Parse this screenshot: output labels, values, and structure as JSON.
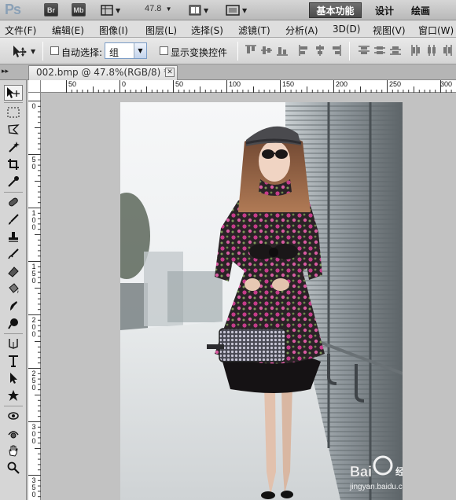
{
  "appbar": {
    "logo": "Ps",
    "bridge_btn": "Br",
    "minibridge_btn": "Mb",
    "zoom": "47.8",
    "workspaces": {
      "active": "基本功能",
      "items": [
        "设计",
        "绘画"
      ]
    }
  },
  "menu": [
    "文件(F)",
    "编辑(E)",
    "图像(I)",
    "图层(L)",
    "选择(S)",
    "滤镜(T)",
    "分析(A)",
    "3D(D)",
    "视图(V)",
    "窗口(W)"
  ],
  "options": {
    "auto_select_label": "自动选择:",
    "auto_select_value": "组",
    "show_transform_label": "显示变换控件"
  },
  "document": {
    "tab_title": "002.bmp @ 47.8%(RGB/8) *",
    "close_glyph": "✕"
  },
  "ruler": {
    "top_labels": [
      "50",
      "0",
      "50",
      "100",
      "150",
      "200",
      "250",
      "300"
    ],
    "left_labels": [
      "0",
      "5\n0",
      "1\n0\n0",
      "1\n5\n0",
      "2\n0\n0",
      "2\n5\n0",
      "3\n0\n0",
      "3\n5\n0"
    ]
  },
  "tools": [
    "move-tool",
    "marquee-tool",
    "lasso-tool",
    "quick-select-tool",
    "crop-tool",
    "eyedropper-tool",
    "healing-brush-tool",
    "brush-tool",
    "clone-stamp-tool",
    "history-brush-tool",
    "eraser-tool",
    "gradient-tool",
    "blur-tool",
    "dodge-tool",
    "pen-tool",
    "type-tool",
    "path-select-tool",
    "shape-tool",
    "3d-rotate-tool",
    "3d-orbit-tool",
    "hand-tool",
    "zoom-tool"
  ],
  "watermark": {
    "brand": "Bai",
    "suffix": "经验",
    "url": "jingyan.baidu.com"
  }
}
